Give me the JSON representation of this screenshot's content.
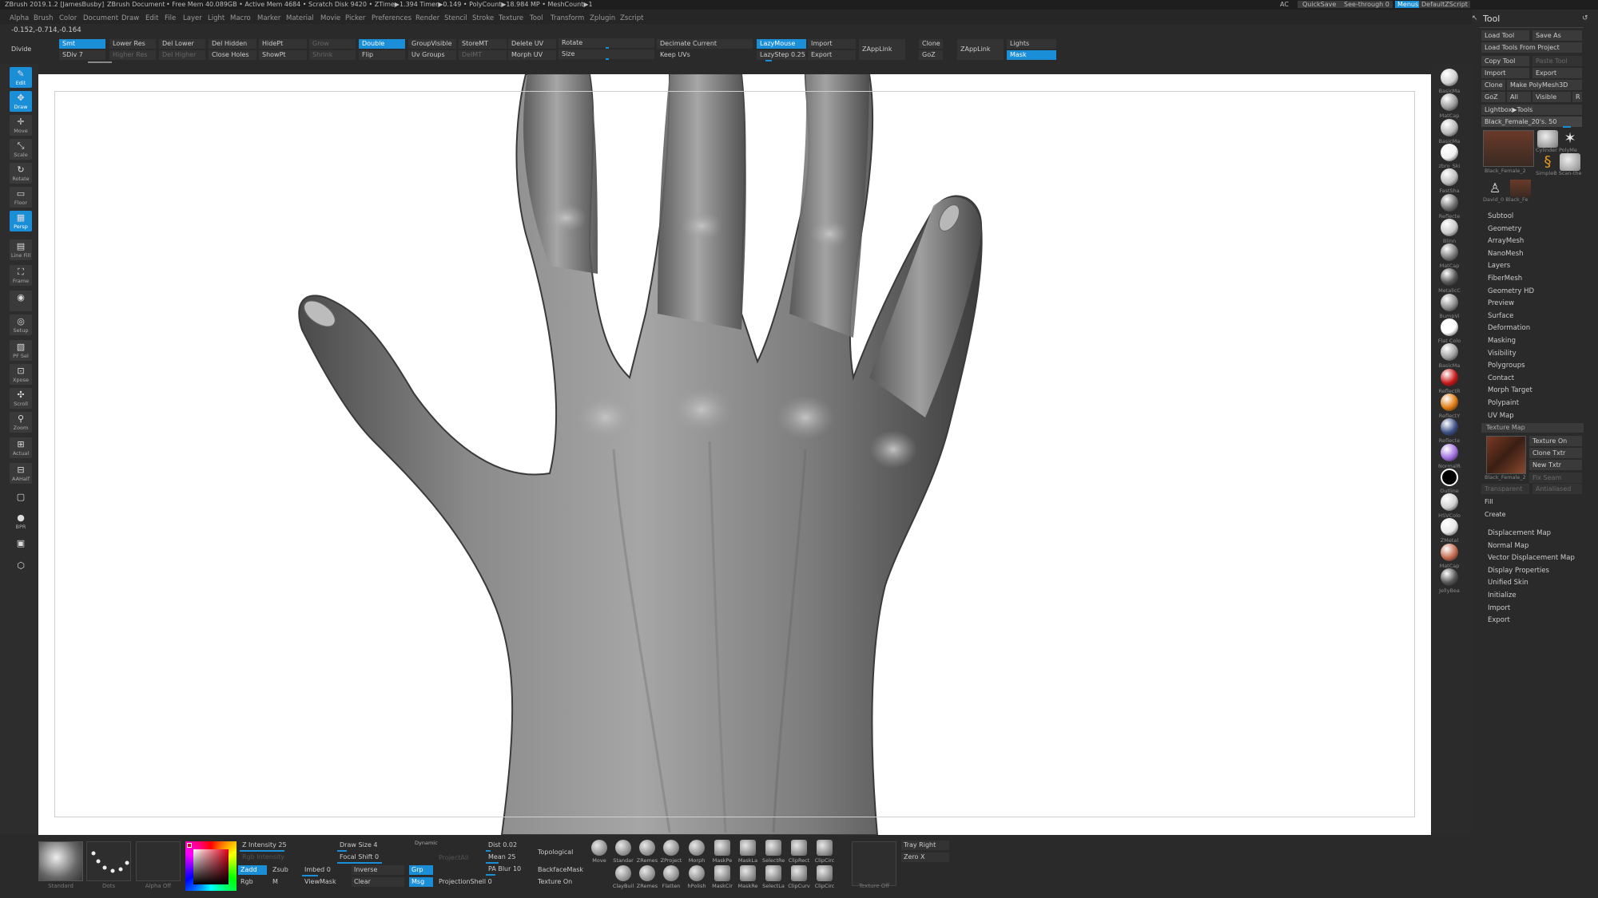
{
  "titlebar": {
    "app": "ZBrush 2019.1.2 [JamesBusby]",
    "doc": "ZBrush Document",
    "stats": "• Free Mem 40.089GB • Active Mem 4684 • Scratch Disk 9420 • ZTime▶1.394 Timer▶0.149 • PolyCount▶18.984 MP • MeshCount▶1",
    "ac": "AC",
    "quicksave": "QuickSave",
    "seethrough": "See-through  0",
    "menus": "Menus",
    "defaultzscript": "DefaultZScript"
  },
  "menubar": [
    "Alpha",
    "Brush",
    "Color",
    "Document",
    "Draw",
    "Edit",
    "File",
    "Layer",
    "Light",
    "Macro",
    "Marker",
    "Material",
    "Movie",
    "Picker",
    "Preferences",
    "Render",
    "Stencil",
    "Stroke",
    "Texture",
    "Tool",
    "Transform",
    "Zplugin",
    "Zscript"
  ],
  "coords": "-0.152,-0.714,-0.164",
  "toolbar": {
    "divide": "Divide",
    "smt": "Smt",
    "sdiv": "SDiv 7",
    "lower_res": "Lower Res",
    "higher_res": "Higher Res",
    "del_lower": "Del Lower",
    "del_higher": "Del Higher",
    "del_hidden": "Del Hidden",
    "close_holes": "Close Holes",
    "hidept": "HidePt",
    "showpt": "ShowPt",
    "grow": "Grow",
    "shrink": "Shrink",
    "double": "Double",
    "flip": "Flip",
    "groupvisible": "GroupVisible",
    "uvgroups": "Uv Groups",
    "storemt": "StoreMT",
    "delmt": "DelMT",
    "deleteuv": "Delete UV",
    "morphuv": "Morph UV",
    "rotate": "Rotate",
    "size": "Size",
    "decimate": "Decimate Current",
    "keepuvs": "Keep UVs",
    "lazymouse": "LazyMouse",
    "lazystep": "LazyStep 0.25",
    "import": "Import",
    "export": "Export",
    "zapplink1": "ZAppLink",
    "clone": "Clone",
    "goz": "GoZ",
    "zapplink2": "ZAppLink",
    "lights": "Lights",
    "mask": "Mask"
  },
  "lefttray": [
    {
      "label": "Edit",
      "icon": "✎",
      "on": true
    },
    {
      "label": "Draw",
      "icon": "✥",
      "on": true
    },
    {
      "label": "Move",
      "icon": "✛",
      "on": false
    },
    {
      "label": "Scale",
      "icon": "⤡",
      "on": false
    },
    {
      "label": "Rotate",
      "icon": "↻",
      "on": false
    },
    {
      "label": "Floor",
      "icon": "▭",
      "on": false
    },
    {
      "label": "Persp",
      "icon": "▦",
      "on": true
    },
    {
      "label": "Line Fill",
      "icon": "▤",
      "on": false
    },
    {
      "label": "Frame",
      "icon": "⛶",
      "on": false
    },
    {
      "label": "",
      "icon": "◉",
      "on": false
    },
    {
      "label": "Setup",
      "icon": "◎",
      "on": false
    },
    {
      "label": "PF Sel",
      "icon": "▧",
      "on": false
    },
    {
      "label": "Xpose",
      "icon": "⊡",
      "on": false
    },
    {
      "label": "Scroll",
      "icon": "✣",
      "on": false
    },
    {
      "label": "Zoom",
      "icon": "⚲",
      "on": false
    },
    {
      "label": "Actual",
      "icon": "⊞",
      "on": false
    },
    {
      "label": "AAHalf",
      "icon": "⊟",
      "on": false
    },
    {
      "label": "",
      "icon": "▢",
      "on": false
    },
    {
      "label": "BPR",
      "icon": "●",
      "on": false
    },
    {
      "label": "",
      "icon": "▣",
      "on": false
    },
    {
      "label": "",
      "icon": "⬡",
      "on": false
    }
  ],
  "materials": [
    {
      "label": "BasicMa",
      "color": "#cfcfcf"
    },
    {
      "label": "MatCap",
      "color": "#9a9a9a"
    },
    {
      "label": "BasicMa",
      "color": "#b8b8b8"
    },
    {
      "label": "zbro_Ski",
      "color": "#f0f0f0"
    },
    {
      "label": "FastSha",
      "color": "#bdbdbd"
    },
    {
      "label": "Reflecte",
      "color": "#6f6f6f"
    },
    {
      "label": "Blinn",
      "color": "#c9c9c9"
    },
    {
      "label": "MatCap",
      "color": "#7a7a7a"
    },
    {
      "label": "MetalicC",
      "color": "#555555"
    },
    {
      "label": "BumpVi",
      "color": "#8c8c8c"
    },
    {
      "label": "Flat Colo",
      "color": "#ffffff"
    },
    {
      "label": "BasicMa",
      "color": "#9f9f9f"
    },
    {
      "label": "ReflectR",
      "color": "#c81818"
    },
    {
      "label": "ReflectY",
      "color": "#e07a10"
    },
    {
      "label": "Reflecte",
      "color": "#3c4f86"
    },
    {
      "label": "NormalR",
      "color": "#a070e0"
    },
    {
      "label": "Outline",
      "color": "#000000"
    },
    {
      "label": "HSVColo",
      "color": "#d0d0d0"
    },
    {
      "label": "ZMetal",
      "color": "#e8e8e8"
    },
    {
      "label": "MatCap",
      "color": "#c46a4e"
    },
    {
      "label": "JellyBea",
      "color": "#555555"
    }
  ],
  "toolpanel": {
    "title": "Tool",
    "load_tool": "Load Tool",
    "save_as": "Save As",
    "load_from_project": "Load Tools From Project",
    "copy_tool": "Copy Tool",
    "paste_tool": "Paste Tool",
    "import": "Import",
    "export": "Export",
    "clone": "Clone",
    "make_polymesh": "Make PolyMesh3D",
    "goz": "GoZ",
    "all": "All",
    "visible": "Visible",
    "r": "R",
    "lightbox": "Lightbox▶Tools",
    "current_tool": "Black_Female_20's. 50",
    "thumbs": [
      "Black_Female_2",
      "Cylinder PolyMe",
      "SimpleB Scan-the",
      "David_0 Black_Fe"
    ],
    "subpalettes": [
      "Subtool",
      "Geometry",
      "ArrayMesh",
      "NanoMesh",
      "Layers",
      "FiberMesh",
      "Geometry HD",
      "Preview",
      "Surface",
      "Deformation",
      "Masking",
      "Visibility",
      "Polygroups",
      "Contact",
      "Morph Target",
      "Polypaint",
      "UV Map"
    ],
    "texture_map": "Texture Map",
    "texture_on": "Texture On",
    "clone_txtr": "Clone Txtr",
    "new_txtr": "New Txtr",
    "tex_name": "Black_Female_2",
    "fix_seam": "Fix Seam",
    "transparent": "Transparent",
    "antialiased": "Antialiased",
    "fill": "Fill",
    "create": "Create",
    "subpalettes2": [
      "Displacement Map",
      "Normal Map",
      "Vector Displacement Map",
      "Display Properties",
      "Unified Skin",
      "Initialize",
      "Import",
      "Export"
    ]
  },
  "bottom": {
    "brush_label": "Standard",
    "stroke_label": "Dots",
    "alpha_label": "Alpha Off",
    "texture_label": "Texture Off",
    "z_intensity": "Z Intensity 25",
    "rgb_intensity": "Rgb Intensity",
    "zadd": "Zadd",
    "zsub": "Zsub",
    "rgb": "Rgb",
    "m": "M",
    "imbed": "Imbed 0",
    "viewmask": "ViewMask",
    "draw_size": "Draw Size 4",
    "dynamic": "Dynamic",
    "focal_shift": "Focal Shift 0",
    "inverse": "Inverse",
    "clear": "Clear",
    "grp": "Grp",
    "msg": "Msg",
    "projectall": "ProjectAll",
    "projshell": "ProjectionShell 0",
    "dist": "Dist 0.02",
    "mean": "Mean 25",
    "pablur": "PA Blur 10",
    "topological": "Topological",
    "backface": "BackfaceMask",
    "texture_on": "Texture On",
    "tray_right": "Tray Right",
    "zero_x": "Zero X",
    "brushes_row1": [
      "Move",
      "Standar",
      "ZRemes",
      "ZProject",
      "Morph",
      "MaskPe",
      "MaskLa",
      "SelectRe",
      "ClipRect",
      "ClipCirc"
    ],
    "brushes_row2": [
      "ClayBuil",
      "ZRemes",
      "Flatten",
      "hPolish",
      "MaskCir",
      "MaskRe",
      "SelectLa",
      "ClipCurv",
      "ClipCirc"
    ]
  }
}
